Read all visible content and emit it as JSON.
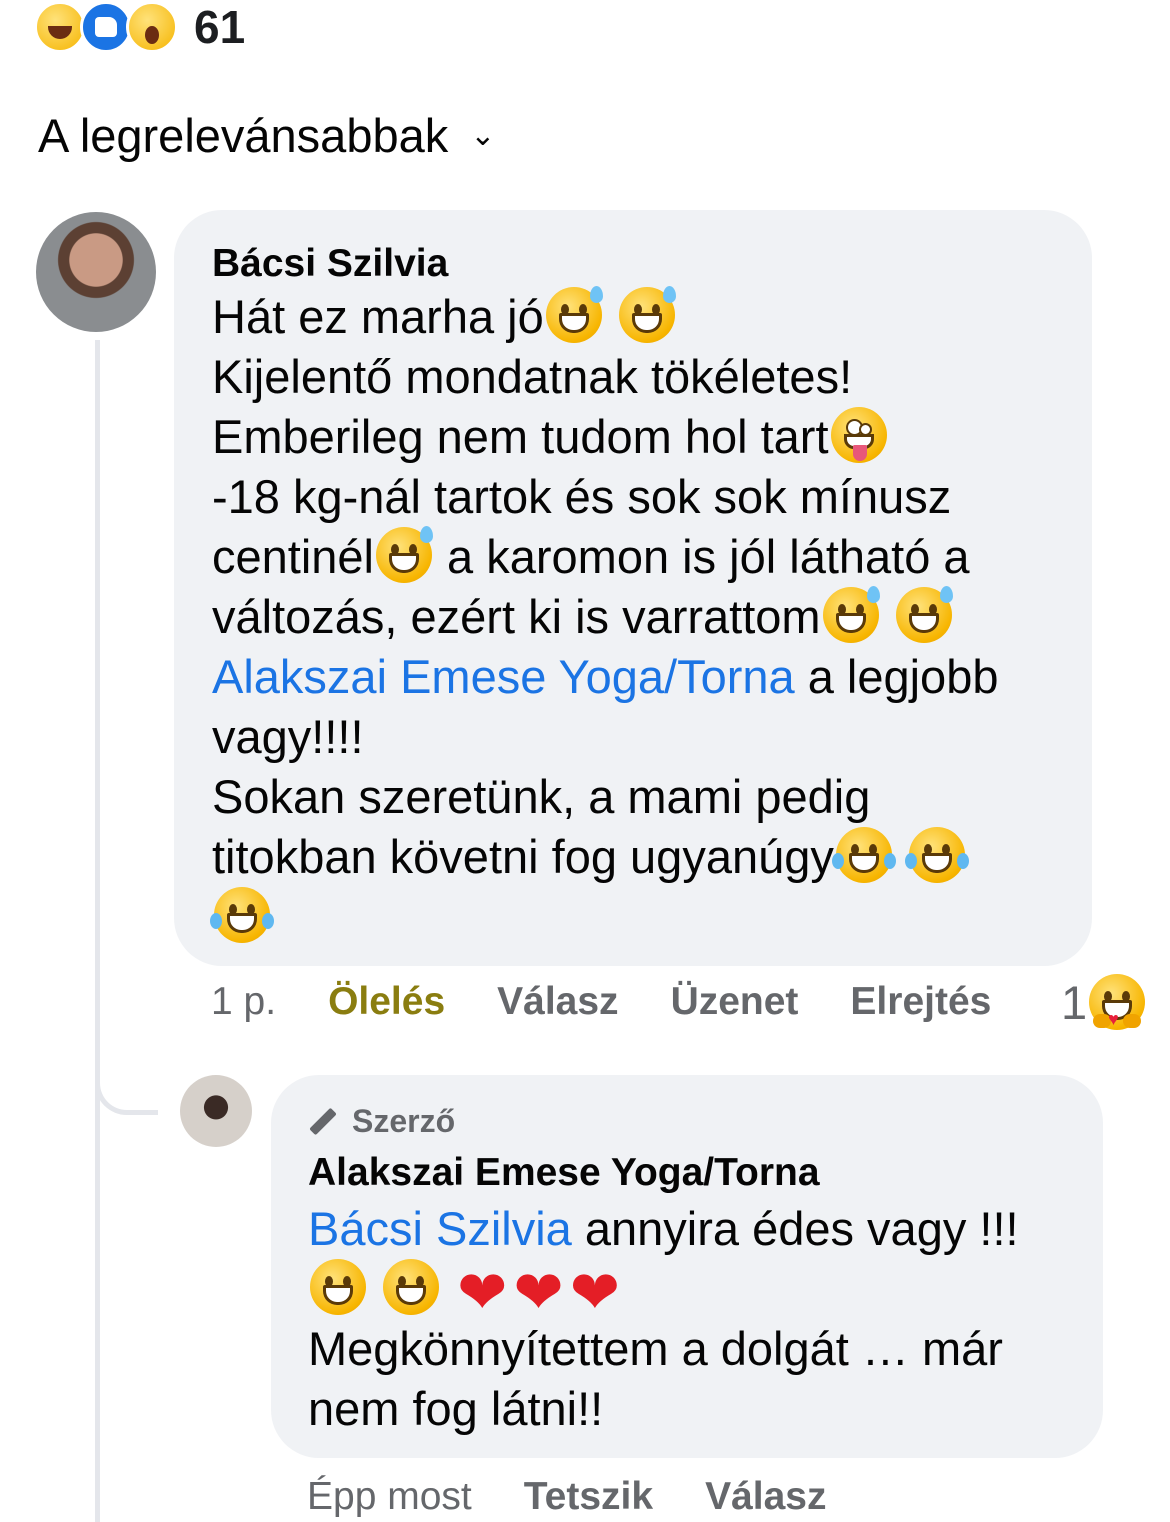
{
  "reactions": {
    "icons": [
      "haha-icon",
      "like-icon",
      "wow-icon"
    ],
    "count": "61"
  },
  "sort": {
    "label": "A legrelevánsabbak"
  },
  "comment": {
    "author": "Bácsi Szilvia",
    "lines": [
      "Hát ez marha jó",
      "Kijelentő mondatnak tökéletes!",
      "Emberileg nem tudom hol tart",
      "-18 kg-nál tartok és sok sok mínusz",
      "centinél",
      " a karomon is jól látható a",
      "változás, ezért ki is varrattom",
      "Alakszai Emese Yoga/Torna",
      " a legjobb",
      "vagy!!!!",
      "Sokan szeretünk, a mami pedig",
      "titokban követni fog ugyanúgy"
    ],
    "time": "1 p.",
    "actions": {
      "hug": "Ölelés",
      "reply": "Válasz",
      "message": "Üzenet",
      "hide": "Elrejtés"
    },
    "reaction_count": "1"
  },
  "reply": {
    "badge": "Szerző",
    "author": "Alakszai Emese Yoga/Torna",
    "mention": "Bácsi Szilvia",
    "line1_rest": " annyira édes vagy !!!",
    "line3": "Megkönnyítettem a dolgát … már",
    "line4": "nem fog látni!!",
    "time": "Épp most",
    "actions": {
      "like": "Tetszik",
      "reply": "Válasz"
    }
  },
  "colors": {
    "link": "#1b74e4",
    "bubble": "#f0f2f5",
    "muted": "#65676b",
    "hug": "#8a7d10"
  }
}
